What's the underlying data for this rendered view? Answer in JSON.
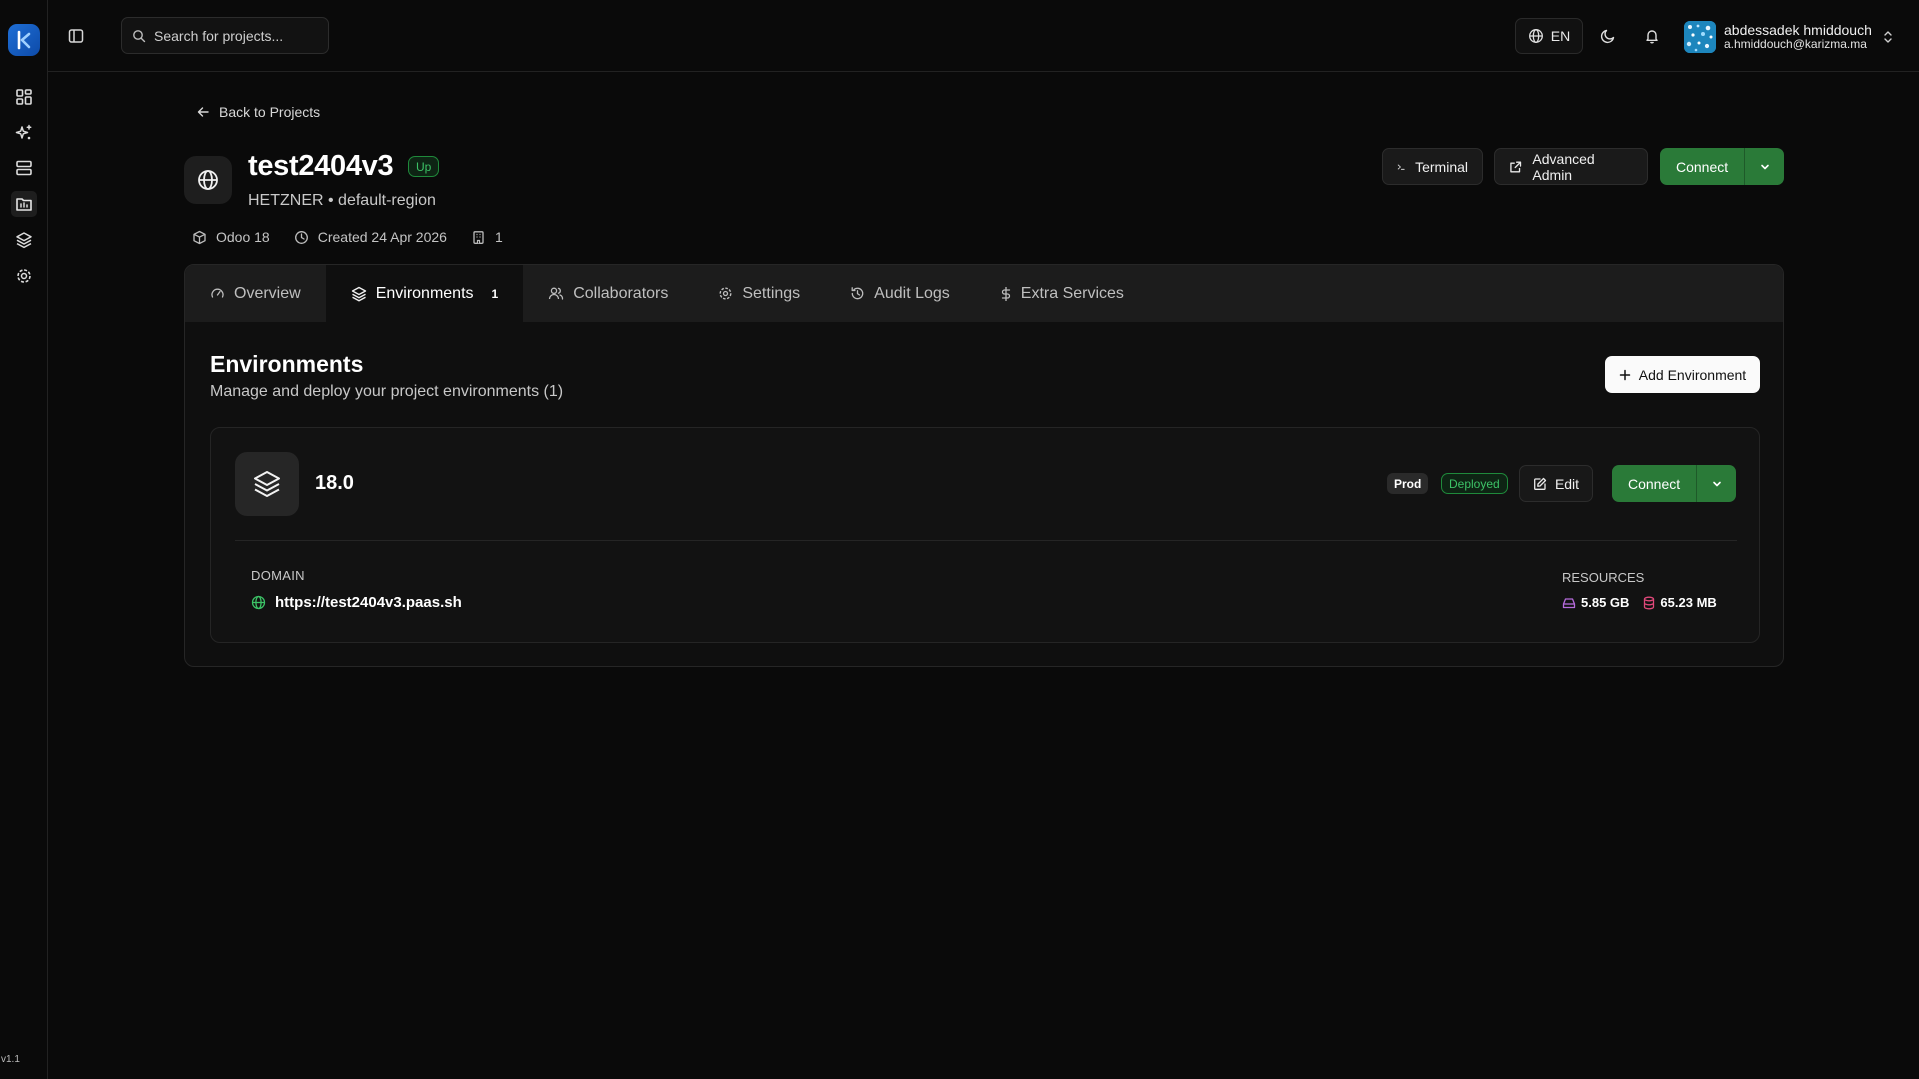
{
  "rail": {
    "logo_text": "k",
    "version": "v1.1",
    "items": [
      {
        "icon": "dashboard-icon"
      },
      {
        "icon": "sparkles-icon"
      },
      {
        "icon": "servers-icon"
      },
      {
        "icon": "projects-icon",
        "active": true
      },
      {
        "icon": "layers-icon"
      },
      {
        "icon": "settings-gear-icon"
      }
    ]
  },
  "topbar": {
    "search_placeholder": "Search for projects...",
    "lang": "EN",
    "user": {
      "name": "abdessadek hmiddouch",
      "email": "a.hmiddouch@karizma.ma"
    }
  },
  "project": {
    "back_label": "Back to Projects",
    "name": "test2404v3",
    "status": "Up",
    "provider": "HETZNER • default-region",
    "meta": {
      "version": "Odoo 18",
      "created": "Created 24 Apr 2026",
      "environments_count": "1"
    },
    "actions": {
      "terminal": "Terminal",
      "advanced_admin": "Advanced Admin",
      "connect": "Connect"
    }
  },
  "tabs": [
    {
      "label": "Overview",
      "icon": "gauge-icon"
    },
    {
      "label": "Environments",
      "icon": "layers-icon",
      "count": "1",
      "active": true
    },
    {
      "label": "Collaborators",
      "icon": "users-icon"
    },
    {
      "label": "Settings",
      "icon": "gear-icon"
    },
    {
      "label": "Audit Logs",
      "icon": "history-icon"
    },
    {
      "label": "Extra Services",
      "icon": "dollar-icon"
    }
  ],
  "environments": {
    "title": "Environments",
    "subtitle": "Manage and deploy your project environments (1)",
    "add_label": "Add Environment",
    "card": {
      "version": "18.0",
      "stage_badge": "Prod",
      "status_badge": "Deployed",
      "edit_label": "Edit",
      "connect_label": "Connect",
      "domain_label": "DOMAIN",
      "domain": "https://test2404v3.paas.sh",
      "resources_label": "RESOURCES",
      "disk": "5.85 GB",
      "memory": "65.23 MB"
    }
  },
  "colors": {
    "accent_green": "#2a7a38",
    "status_green": "#3cc266",
    "disk_icon": "#b66bdc",
    "memory_icon": "#e0487a"
  }
}
